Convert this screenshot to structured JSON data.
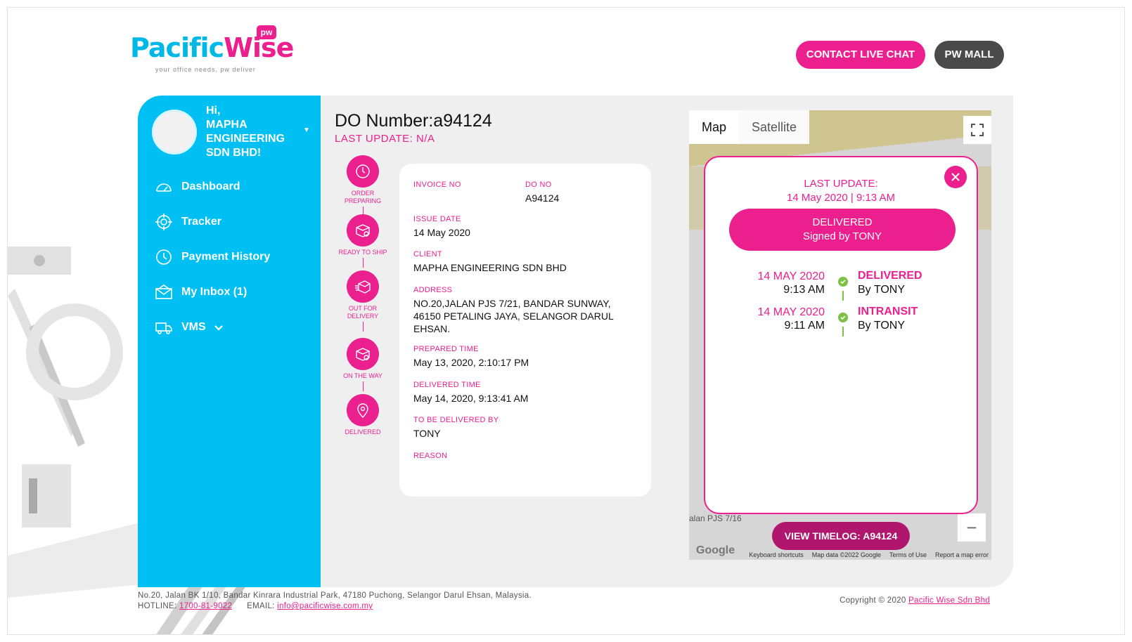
{
  "brand": {
    "logo_pacific": "Pacific",
    "logo_wise": "Wise",
    "logo_badge": "pw",
    "tagline": "your office needs, pw deliver",
    "pink": "#ec1f8f",
    "blue": "#00c0f3"
  },
  "header": {
    "chat_label": "CONTACT LIVE CHAT",
    "mall_label": "PW MALL"
  },
  "user": {
    "greeting": "Hi,",
    "name": "MAPHA ENGINEERING SDN BHD!"
  },
  "sidebar": {
    "items": [
      {
        "label": "Dashboard",
        "icon": "gauge-icon"
      },
      {
        "label": "Tracker",
        "icon": "crosshair-icon"
      },
      {
        "label": "Payment History",
        "icon": "clock-icon"
      },
      {
        "label": "My Inbox (1)",
        "icon": "envelope-icon"
      },
      {
        "label": "VMS",
        "icon": "truck-icon"
      }
    ]
  },
  "order": {
    "title": "DO Number:a94124",
    "last_update": "LAST UPDATE: N/A"
  },
  "steps": [
    {
      "label": "ORDER PREPARING",
      "icon": "clock-icon"
    },
    {
      "label": "READY TO SHIP",
      "icon": "box-check-icon"
    },
    {
      "label": "OUT FOR DELIVERY",
      "icon": "box-moving-icon"
    },
    {
      "label": "ON THE WAY",
      "icon": "box-check-icon"
    },
    {
      "label": "DELIVERED",
      "icon": "location-pin-icon"
    }
  ],
  "details": {
    "invoice_label": "INVOICE NO",
    "invoice_value": "",
    "do_label": "DO NO",
    "do_value": "A94124",
    "issue_label": "ISSUE DATE",
    "issue_value": "14 May 2020",
    "client_label": "CLIENT",
    "client_value": "MAPHA ENGINEERING SDN BHD",
    "address_label": "ADDRESS",
    "address_value": "NO.20,JALAN PJS 7/21, BANDAR SUNWAY, 46150 PETALING JAYA, SELANGOR DARUL EHSAN.",
    "prepared_label": "PREPARED TIME",
    "prepared_value": "May 13, 2020, 2:10:17 PM",
    "delivered_label": "DELIVERED TIME",
    "delivered_value": "May 14, 2020, 9:13:41 AM",
    "by_label": "TO BE DELIVERED BY",
    "by_value": "TONY",
    "reason_label": "REASON",
    "reason_value": ""
  },
  "map": {
    "tab_map": "Map",
    "tab_satellite": "Satellite",
    "street": "alan PJS 7/16",
    "google": "Google",
    "keyboard": "Keyboard shortcuts",
    "map_data": "Map data ©2022 Google",
    "terms": "Terms of Use",
    "report": "Report a map error",
    "zoom_out": "−",
    "view_timelog": "VIEW TIMELOG: A94124"
  },
  "popup": {
    "last_update_label": "LAST UPDATE:",
    "last_update_value": "14 May 2020 | 9:13 AM",
    "status_main": "DELIVERED",
    "status_sub": "Signed by TONY",
    "timeline": [
      {
        "date": "14 MAY 2020",
        "time": "9:13 AM",
        "status": "DELIVERED",
        "by_prefix": "By",
        "by": "TONY"
      },
      {
        "date": "14 MAY 2020",
        "time": "9:11 AM",
        "status": "INTRANSIT",
        "by_prefix": "By",
        "by": "TONY"
      }
    ]
  },
  "footer": {
    "address": "No.20, Jalan BK 1/10, Bandar Kinrara Industrial Park, 47180 Puchong, Selangor Darul Ehsan, Malaysia.",
    "hotline_label": "HOTLINE:",
    "hotline": "1700-81-9022",
    "email_label": "EMAIL:",
    "email": "info@pacificwise.com.my",
    "copyright": "Copyright © 2020",
    "company": "Pacific Wise Sdn Bhd"
  }
}
